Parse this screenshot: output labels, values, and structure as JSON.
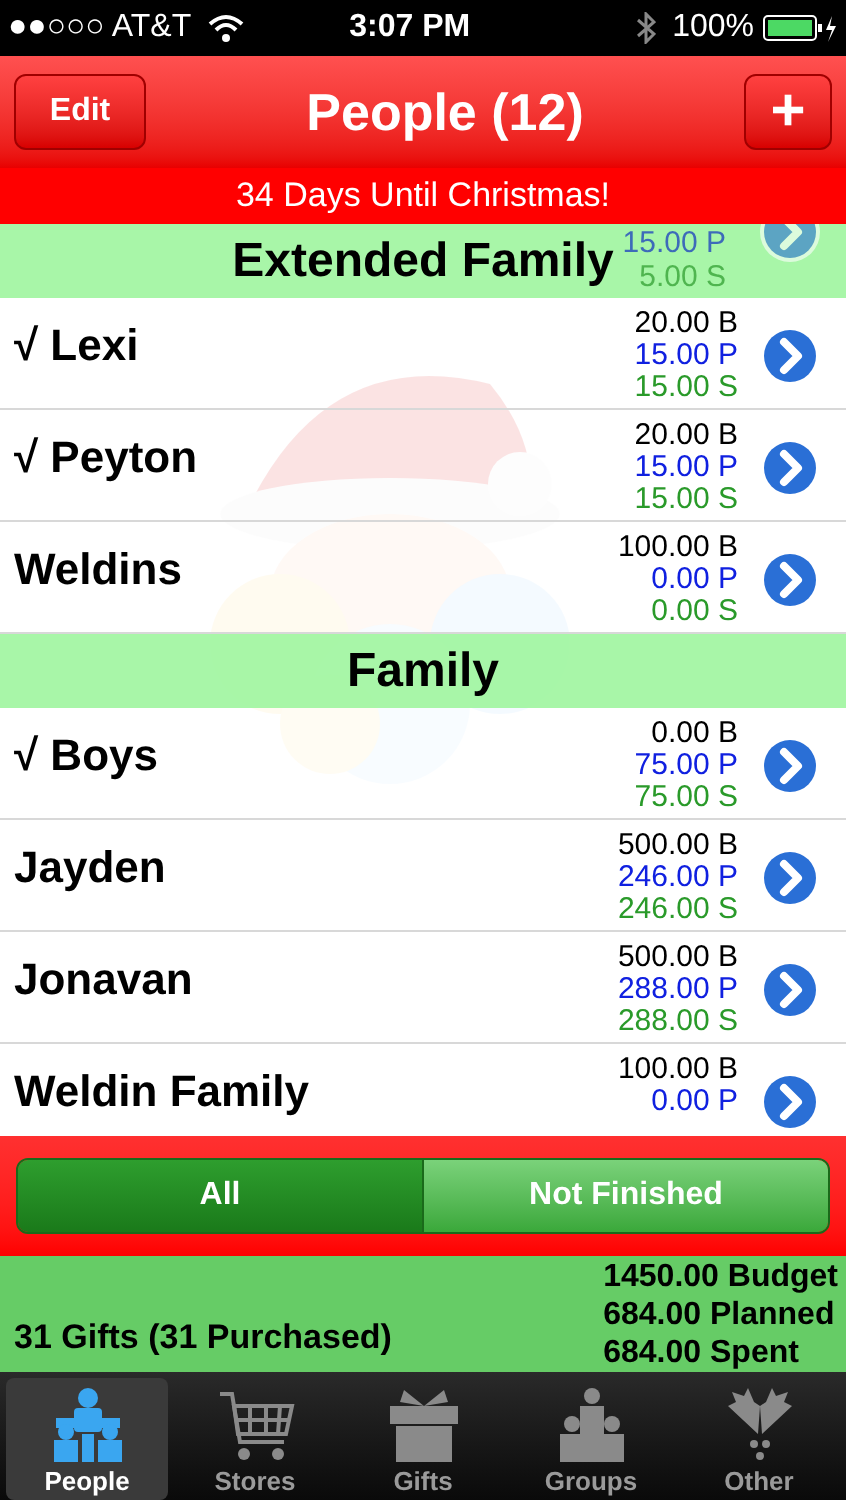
{
  "status_bar": {
    "carrier": "●●○○○ AT&T",
    "time": "3:07 PM",
    "battery": "100%"
  },
  "nav": {
    "title": "People (12)",
    "left_button": "Edit",
    "right_button": "+"
  },
  "banner": "34 Days Until Christmas!",
  "partial_row": {
    "planned": "15.00 P",
    "spent": "5.00 S"
  },
  "sections": [
    {
      "title": "Extended Family",
      "rows": [
        {
          "name": "√ Lexi",
          "budget": "20.00 B",
          "planned": "15.00 P",
          "spent": "15.00 S"
        },
        {
          "name": "√ Peyton",
          "budget": "20.00 B",
          "planned": "15.00 P",
          "spent": "15.00 S"
        },
        {
          "name": "Weldins",
          "budget": "100.00 B",
          "planned": "0.00 P",
          "spent": "0.00 S"
        }
      ]
    },
    {
      "title": "Family",
      "rows": [
        {
          "name": "√ Boys",
          "budget": "0.00 B",
          "planned": "75.00 P",
          "spent": "75.00 S"
        },
        {
          "name": "Jayden",
          "budget": "500.00 B",
          "planned": "246.00 P",
          "spent": "246.00 S"
        },
        {
          "name": "Jonavan",
          "budget": "500.00 B",
          "planned": "288.00 P",
          "spent": "288.00 S"
        },
        {
          "name": "Weldin Family",
          "budget": "100.00 B",
          "planned": "0.00 P"
        }
      ]
    }
  ],
  "filter": [
    {
      "label": "All",
      "selected": true
    },
    {
      "label": "Not Finished",
      "selected": false
    }
  ],
  "summary": {
    "gifts": "31 Gifts (31 Purchased)",
    "totals": [
      "1450.00 Budget",
      "684.00 Planned",
      "684.00 Spent"
    ]
  },
  "tabs": [
    {
      "label": "People",
      "kind": "people",
      "selected": true
    },
    {
      "label": "Stores",
      "kind": "cart",
      "selected": false
    },
    {
      "label": "Gifts",
      "kind": "gift",
      "selected": false
    },
    {
      "label": "Groups",
      "kind": "group",
      "selected": false
    },
    {
      "label": "Other",
      "kind": "holly",
      "selected": false
    }
  ]
}
